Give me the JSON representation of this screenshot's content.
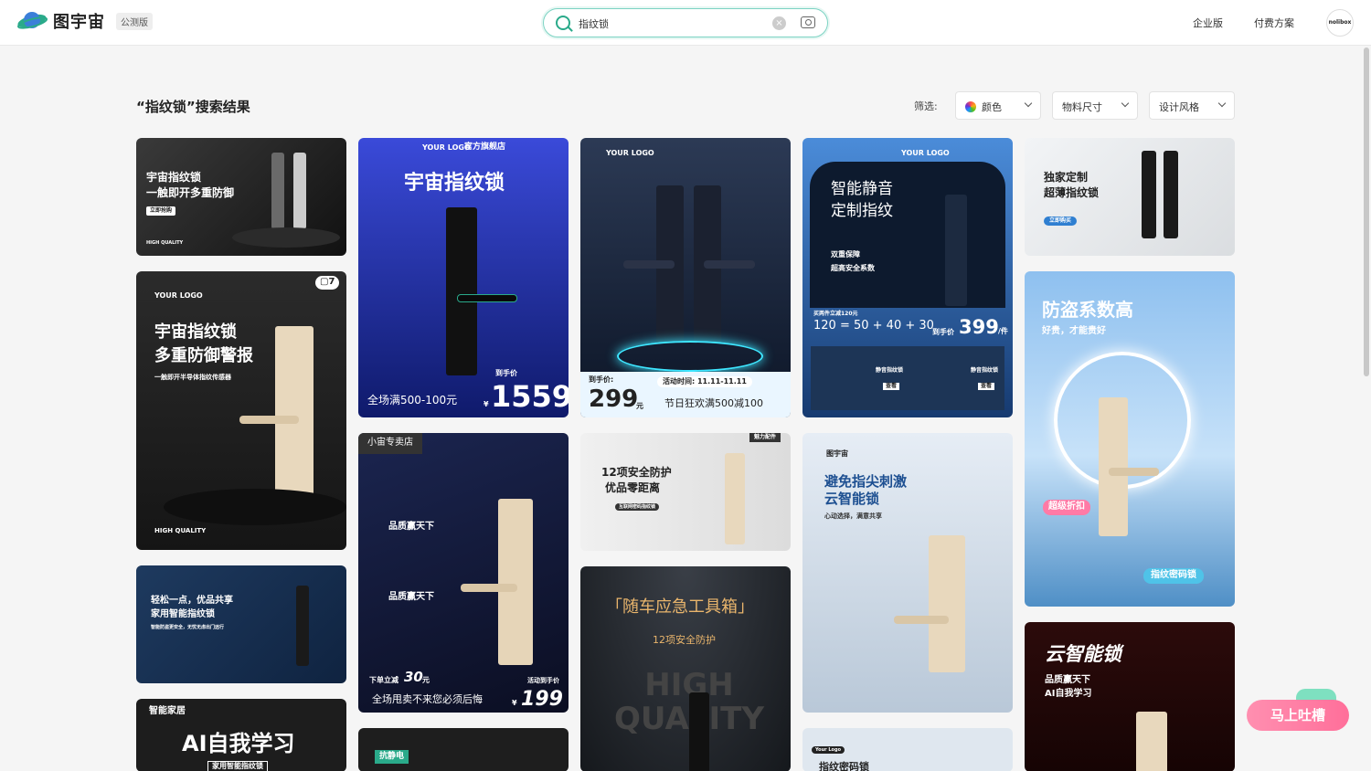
{
  "header": {
    "logo_text": "图宇宙",
    "beta_badge": "公测版",
    "search": {
      "value": "指纹锁",
      "placeholder": ""
    },
    "nav": {
      "enterprise": "企业版",
      "pricing": "付费方案"
    },
    "avatar_text": "nolibox"
  },
  "results": {
    "title": "“指纹锁”搜索结果",
    "filter_label": "筛选:",
    "filters": {
      "color": "颜色",
      "size": "物料尺寸",
      "style": "设计风格"
    }
  },
  "cards": {
    "c1": {
      "line1": "宇宙指纹锁",
      "line2": "一触即开多重防御",
      "btn": "立即抢购",
      "tag": "HIGH QUALITY"
    },
    "c2": {
      "logo": "YOUR LOGO",
      "store": "官方旗舰店",
      "title": "宇宙指纹锁",
      "promo": "全场满500-100元",
      "price_label": "到手价",
      "currency": "¥",
      "price": "1559"
    },
    "c3": {
      "logo": "YOUR LOGO",
      "price_label": "到手价:",
      "price": "299",
      "unit": "元",
      "time": "活动时间: 11.11-11.11",
      "promo": "节日狂欢满500减100"
    },
    "c4": {
      "logo": "YOUR LOGO",
      "line1": "智能静音",
      "line2": "定制指纹",
      "sub1": "双重保障",
      "sub2": "超高安全系数",
      "calc_label": "买两件立减120元",
      "calc": "120 = 50 + 40 + 30",
      "price_label": "到手价",
      "price": "399",
      "unit": "/件",
      "p1": "静音指纹锁",
      "p2": "静音指纹锁",
      "view": "查看"
    },
    "c5": {
      "line1": "独家定制",
      "line2": "超薄指纹锁",
      "btn": "立即购买"
    },
    "c6": {
      "count": "7",
      "logo": "YOUR LOGO",
      "line1": "宇宙指纹锁",
      "line2": "多重防御警报",
      "sub": "一触即开半导体指纹传感器",
      "tag": "HIGH QUALITY"
    },
    "c7": {
      "store": "小宙专卖店",
      "badge1": "品质赢天下",
      "badge2": "品质赢天下",
      "discount_label": "下单立减",
      "discount": "30",
      "discount_unit": "元",
      "promo": "全场甩卖不来您必须后悔",
      "price_label": "活动到手价",
      "currency": "¥",
      "price": "199"
    },
    "c8": {
      "tag": "魅力配件",
      "line1": "12项安全防护",
      "line2": "优品零距离",
      "btn": "互联网密码指纹锁"
    },
    "c9": {
      "brand": "图宇宙",
      "line1": "避免指尖刺激",
      "line2": "云智能锁",
      "sub": "心动选择，满意共享"
    },
    "c10": {
      "title": "防盗系数高",
      "sub": "好贵，才能贵好",
      "badge": "超级折扣",
      "btn": "指纹密码锁"
    },
    "c11": {
      "line1": "轻松一点，优品共享",
      "line2": "家用智能指纹锁",
      "sub": "智能防盗更安全，无忧无虑出门远行"
    },
    "c12": {
      "title": "「随车应急工具箱」",
      "sub": "12项安全防护",
      "bg": "HIGH QUALITY"
    },
    "c13": {
      "title": "云智能锁",
      "sub1": "品质赢天下",
      "sub2": "AI自我学习"
    },
    "c14": {
      "tag": "智能家居",
      "title": "AI自我学习",
      "sub": "家用智能指纹锁"
    },
    "c15": {
      "tag": "抗静电"
    },
    "c16": {
      "logo": "Your Logo",
      "title": "指纹密码锁"
    }
  },
  "feedback": {
    "label": "马上吐槽"
  },
  "colors": {
    "accent": "#2aaa8a",
    "pink": "#ff6f9a"
  }
}
